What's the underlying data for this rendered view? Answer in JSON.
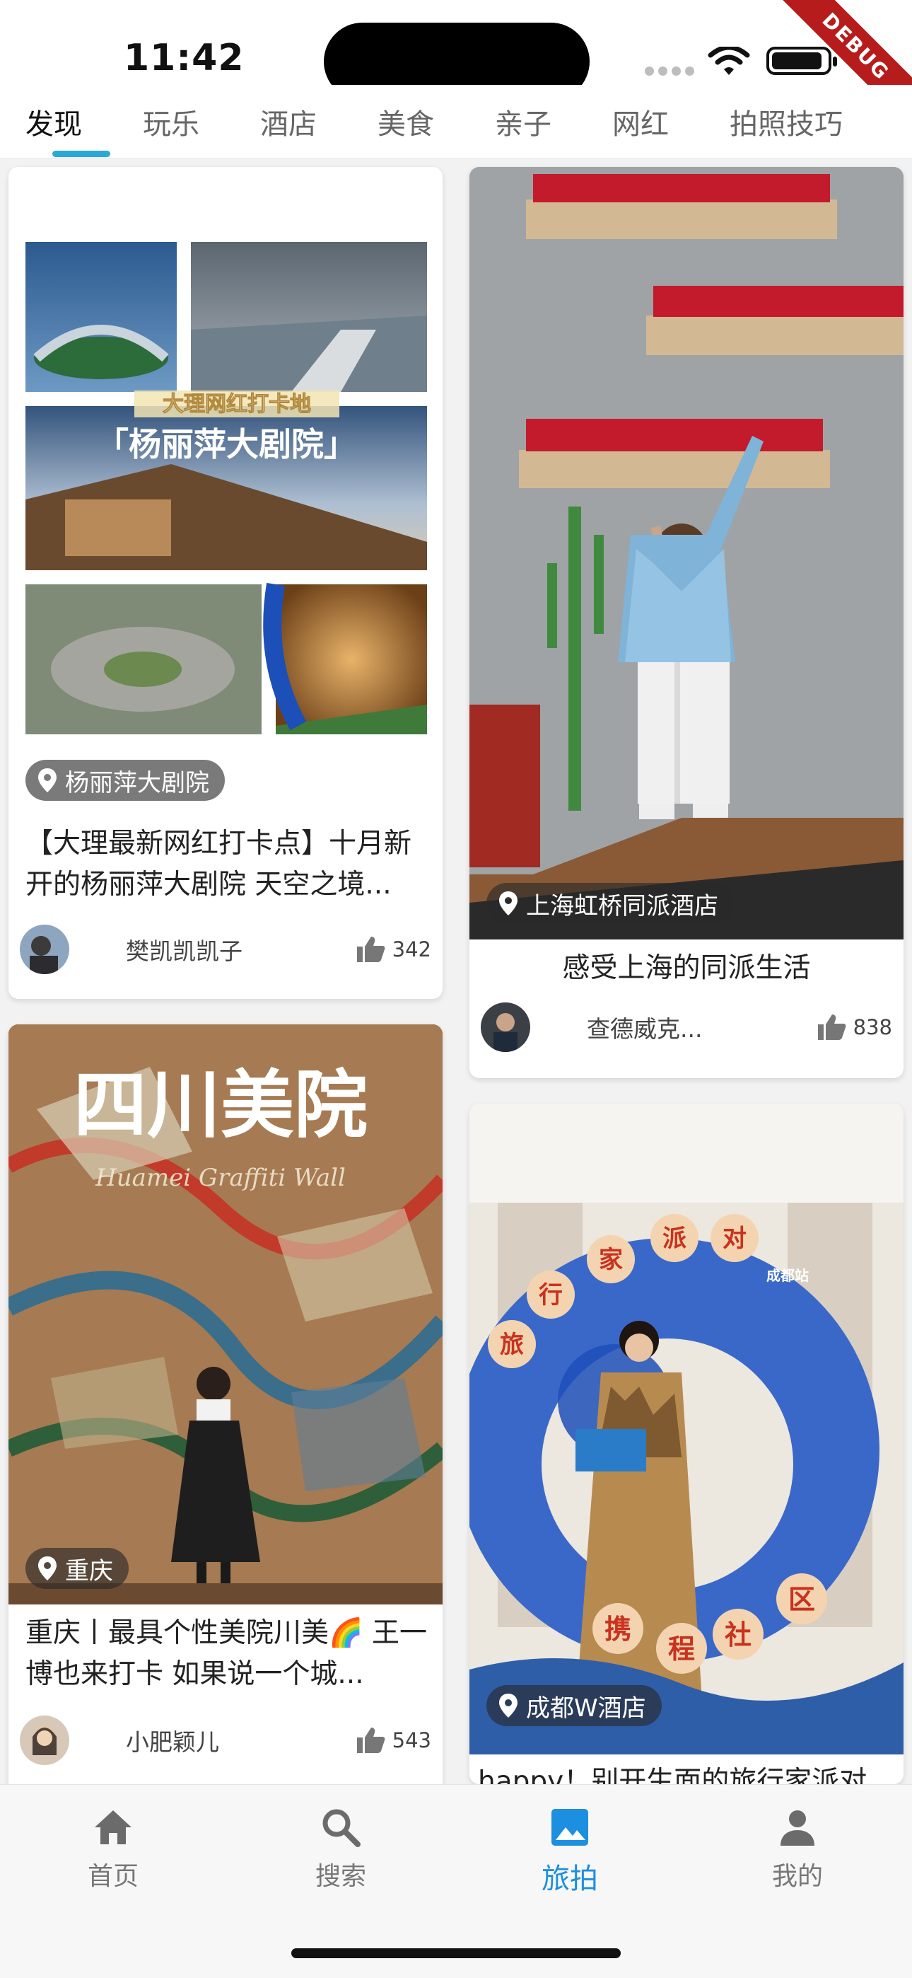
{
  "status": {
    "time": "11:42",
    "debug_label": "DEBUG"
  },
  "tabs": [
    {
      "label": "发现",
      "active": true
    },
    {
      "label": "玩乐"
    },
    {
      "label": "酒店"
    },
    {
      "label": "美食"
    },
    {
      "label": "亲子"
    },
    {
      "label": "网红"
    },
    {
      "label": "拍照技巧"
    }
  ],
  "feed": {
    "cards": [
      {
        "location": "杨丽萍大剧院",
        "title": "【大理最新网红打卡点】十月新开的杨丽萍大剧院 天空之境...",
        "author": "樊凯凯凯子",
        "likes": "342",
        "image_text": {
          "caption": "大理网红打卡地",
          "headline": "「杨丽萍大剧院」"
        }
      },
      {
        "location": "上海虹桥同派酒店",
        "title": "感受上海的同派生活",
        "author": "查德威克...",
        "likes": "838"
      },
      {
        "location": "重庆",
        "title": "重庆丨最具个性美院川美🌈 王一博也来打卡 如果说一个城...",
        "author": "小肥颖儿",
        "likes": "543",
        "image_text": {
          "headline": "四川美院",
          "script": "Huamei Graffiti Wall"
        }
      },
      {
        "location": "成都W酒店",
        "title": "happy！别开生面的旅行家派对",
        "image_text": {
          "arch_left": "旅行家派对",
          "arch_bottom": "携程社区",
          "sign": "成都站"
        }
      }
    ]
  },
  "bottom_nav": [
    {
      "label": "首页",
      "icon": "home-icon"
    },
    {
      "label": "搜索",
      "icon": "search-icon"
    },
    {
      "label": "旅拍",
      "icon": "photo-icon",
      "active": true
    },
    {
      "label": "我的",
      "icon": "person-icon"
    }
  ],
  "colors": {
    "accent": "#1d8fe0",
    "tab_indicator": "#2ba9d6"
  }
}
